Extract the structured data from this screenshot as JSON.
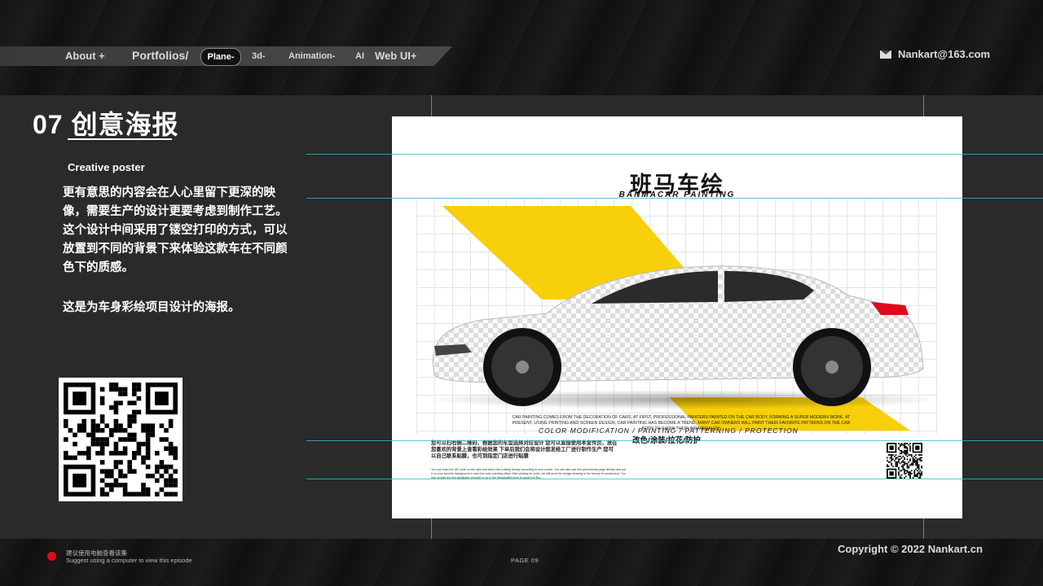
{
  "nav": {
    "about": "About +",
    "portfolios": "Portfolios/",
    "plane": "Plane-",
    "three_d": "3d-",
    "animation": "Animation-",
    "ai": "AI",
    "web_ui": "Web UI+"
  },
  "email": "Nankart@163.com",
  "section": {
    "number_title": "07 创意海报",
    "subtitle": "Creative poster",
    "description": "更有意思的内容会在人心里留下更深的映像，需要生产的设计更要考虑到制作工艺。这个设计中间采用了镂空打印的方式，可以放置到不同的背景下来体验这款车在不同颜色下的质感。",
    "description2": "这是为车身彩绘项目设计的海报。"
  },
  "poster": {
    "title": "班马车绘",
    "subtitle": "BANMACAR PAINTING",
    "description": "Car painting comes from the decoration of cars. At first, professional painters painted on the car body, forming a super modern work. At present, using printing and screen design, car painting has become a trend. Many car owners will paint their favorite patterns on the car body to show their individuality.",
    "categories_en": "COLOR MODIFICATION / PAINTING / PATTERNING / PROTECTION",
    "categories_cn": "改色/涂装/拉花/防护",
    "cn_note": "您可以扫右侧二维码，根据您的车型选择对应设计 您可以直接使用本宣传页，放在您喜欢的背景上查看彩绘效果 下单后我们会将设计图发给工厂进行制作生产 您可以自己联系贴膜，也可到指定门店进行贴膜",
    "en_note": "You can scan the QR code on the right and select the existing design according to your model. You can also use this promotional page directly and put it on your favorite background to view the color painting effect. After placing an order, we will send the design drawing to the factory for production. You can contact the film applicator yourself or go to the designated store to apply the film."
  },
  "footer": {
    "note_cn": "建议使用电脑查看该集",
    "note_en": "Suggest using a computer to view this episode",
    "page": "PAGE  09",
    "copyright": "Copyright © 2022 Nankart.cn"
  },
  "colors": {
    "accent_yellow": "#f7cf0a",
    "guide_cyan": "#3bb8c8",
    "red_dot": "#e0091c",
    "panel": "#2a2a2a"
  }
}
